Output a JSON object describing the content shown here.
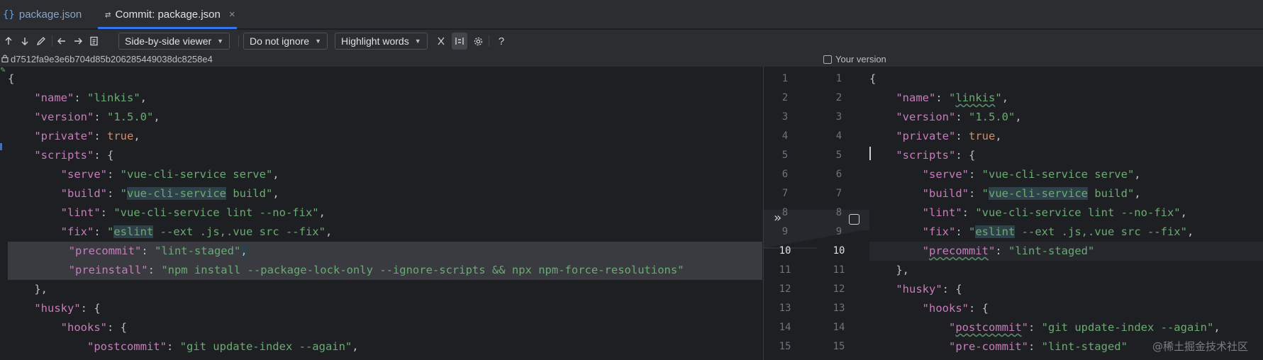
{
  "tabs": [
    {
      "icon": "{}",
      "label": "package.json"
    },
    {
      "icon": "⇄",
      "label": "Commit: package.json",
      "close": "×"
    }
  ],
  "toolbar": {
    "viewer": "Side-by-side viewer",
    "ignore": "Do not ignore",
    "highlight": "Highlight words",
    "help": "?"
  },
  "info": {
    "hash": "d7512fa9e3e6b704d85b206285449038dc8258e4",
    "your_version": "Your version"
  },
  "left_lines": [
    [
      [
        "p",
        "{"
      ]
    ],
    [
      [
        "p",
        "    "
      ],
      [
        "k",
        "\"name\""
      ],
      [
        "p",
        ": "
      ],
      [
        "s",
        "\"linkis\""
      ],
      [
        "p",
        ","
      ]
    ],
    [
      [
        "p",
        "    "
      ],
      [
        "k",
        "\"version\""
      ],
      [
        "p",
        ": "
      ],
      [
        "s",
        "\"1.5.0\""
      ],
      [
        "p",
        ","
      ]
    ],
    [
      [
        "p",
        "    "
      ],
      [
        "k",
        "\"private\""
      ],
      [
        "p",
        ": "
      ],
      [
        "b",
        "true"
      ],
      [
        "p",
        ","
      ]
    ],
    [
      [
        "p",
        "    "
      ],
      [
        "k",
        "\"scripts\""
      ],
      [
        "p",
        ": {"
      ]
    ],
    [
      [
        "p",
        "        "
      ],
      [
        "k",
        "\"serve\""
      ],
      [
        "p",
        ": "
      ],
      [
        "s",
        "\"vue-cli-service serve\""
      ],
      [
        "p",
        ","
      ]
    ],
    [
      [
        "p",
        "        "
      ],
      [
        "k",
        "\"build\""
      ],
      [
        "p",
        ": "
      ],
      [
        "s",
        "\""
      ],
      [
        "sw",
        "vue-cli-service"
      ],
      [
        "s",
        " build\""
      ],
      [
        "p",
        ","
      ]
    ],
    [
      [
        "p",
        "        "
      ],
      [
        "k",
        "\"lint\""
      ],
      [
        "p",
        ": "
      ],
      [
        "s",
        "\"vue-cli-service lint --no-fix\""
      ],
      [
        "p",
        ","
      ]
    ],
    [
      [
        "p",
        "        "
      ],
      [
        "k",
        "\"fix\""
      ],
      [
        "p",
        ": "
      ],
      [
        "s",
        "\""
      ],
      [
        "sw",
        "eslint"
      ],
      [
        "s",
        " --ext .js,.vue src --fix\""
      ],
      [
        "p",
        ","
      ]
    ],
    [
      [
        "p",
        "        "
      ],
      [
        "k",
        "\"precommit\""
      ],
      [
        "p",
        ": "
      ],
      [
        "s",
        "\"lint-staged\""
      ],
      [
        "pw",
        ","
      ]
    ],
    [
      [
        "p",
        "        "
      ],
      [
        "k",
        "\"preinstall\""
      ],
      [
        "p",
        ": "
      ],
      [
        "s",
        "\"npm install --package-lock-only --ignore-scripts && npx npm-force-resolutions\""
      ]
    ],
    [
      [
        "p",
        "    },"
      ]
    ],
    [
      [
        "p",
        "    "
      ],
      [
        "k",
        "\"husky\""
      ],
      [
        "p",
        ": {"
      ]
    ],
    [
      [
        "p",
        "        "
      ],
      [
        "k",
        "\"hooks\""
      ],
      [
        "p",
        ": {"
      ]
    ],
    [
      [
        "p",
        "            "
      ],
      [
        "k",
        "\"postcommit\""
      ],
      [
        "p",
        ": "
      ],
      [
        "s",
        "\"git update-index --again\""
      ],
      [
        "p",
        ","
      ]
    ]
  ],
  "right_lines": [
    [
      [
        "p",
        "{"
      ]
    ],
    [
      [
        "p",
        "    "
      ],
      [
        "k",
        "\"name\""
      ],
      [
        "p",
        ": "
      ],
      [
        "s",
        "\""
      ],
      [
        "sv",
        "linkis"
      ],
      [
        "s",
        "\""
      ],
      [
        "p",
        ","
      ]
    ],
    [
      [
        "p",
        "    "
      ],
      [
        "k",
        "\"version\""
      ],
      [
        "p",
        ": "
      ],
      [
        "s",
        "\"1.5.0\""
      ],
      [
        "p",
        ","
      ]
    ],
    [
      [
        "p",
        "    "
      ],
      [
        "k",
        "\"private\""
      ],
      [
        "p",
        ": "
      ],
      [
        "b",
        "true"
      ],
      [
        "p",
        ","
      ]
    ],
    [
      [
        "p",
        "    "
      ],
      [
        "k",
        "\"scripts\""
      ],
      [
        "p",
        ": {"
      ]
    ],
    [
      [
        "p",
        "        "
      ],
      [
        "k",
        "\"serve\""
      ],
      [
        "p",
        ": "
      ],
      [
        "s",
        "\"vue-cli-service serve\""
      ],
      [
        "p",
        ","
      ]
    ],
    [
      [
        "p",
        "        "
      ],
      [
        "k",
        "\"build\""
      ],
      [
        "p",
        ": "
      ],
      [
        "s",
        "\""
      ],
      [
        "sw",
        "vue-cli-service"
      ],
      [
        "s",
        " build\""
      ],
      [
        "p",
        ","
      ]
    ],
    [
      [
        "p",
        "        "
      ],
      [
        "k",
        "\"lint\""
      ],
      [
        "p",
        ": "
      ],
      [
        "s",
        "\"vue-cli-service lint --no-fix\""
      ],
      [
        "p",
        ","
      ]
    ],
    [
      [
        "p",
        "        "
      ],
      [
        "k",
        "\"fix\""
      ],
      [
        "p",
        ": "
      ],
      [
        "s",
        "\""
      ],
      [
        "sw",
        "eslint"
      ],
      [
        "s",
        " --ext .js,.vue src --fix\""
      ],
      [
        "p",
        ","
      ]
    ],
    [
      [
        "p",
        "        "
      ],
      [
        "k",
        "\""
      ],
      [
        "kv",
        "precommit"
      ],
      [
        "k",
        "\""
      ],
      [
        "p",
        ": "
      ],
      [
        "s",
        "\"lint-staged\""
      ]
    ],
    [
      [
        "p",
        "    },"
      ]
    ],
    [
      [
        "p",
        "    "
      ],
      [
        "k",
        "\"husky\""
      ],
      [
        "p",
        ": {"
      ]
    ],
    [
      [
        "p",
        "        "
      ],
      [
        "k",
        "\"hooks\""
      ],
      [
        "p",
        ": {"
      ]
    ],
    [
      [
        "p",
        "            "
      ],
      [
        "k",
        "\""
      ],
      [
        "kv",
        "postcommit"
      ],
      [
        "k",
        "\""
      ],
      [
        "p",
        ": "
      ],
      [
        "s",
        "\"git update-index --again\""
      ],
      [
        "p",
        ","
      ]
    ],
    [
      [
        "p",
        "            "
      ],
      [
        "k",
        "\"pre-commit\""
      ],
      [
        "p",
        ": "
      ],
      [
        "s",
        "\"lint-staged\""
      ]
    ]
  ],
  "line_numbers": [
    "1",
    "2",
    "3",
    "4",
    "5",
    "6",
    "7",
    "8",
    "9",
    "10",
    "11",
    "12",
    "13",
    "14",
    "15"
  ],
  "apply_arrow": "»",
  "watermark": "@稀土掘金技术社区",
  "colors": {
    "accent": "#3574f0",
    "key": "#c77dbb",
    "string": "#6aab73",
    "bool": "#cf8e6d"
  }
}
